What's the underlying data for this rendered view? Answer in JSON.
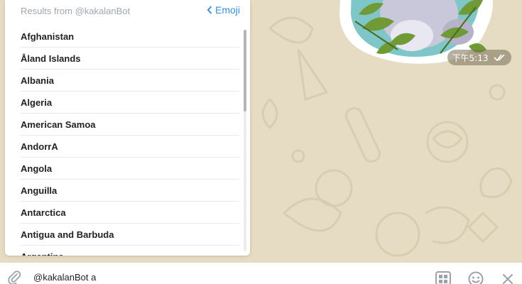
{
  "inline_results": {
    "title": "Results from @kakalanBot",
    "back_button": {
      "label": "Emoji",
      "icon": "chevron-left-icon"
    },
    "items": [
      "Afghanistan",
      "Åland Islands",
      "Albania",
      "Algeria",
      "American Samoa",
      "AndorrA",
      "Angola",
      "Anguilla",
      "Antarctica",
      "Antigua and Barbuda",
      "Argentina"
    ]
  },
  "message": {
    "time": "下午5:13",
    "status_icon": "double-check-icon"
  },
  "composer": {
    "input_value": "@kakalanBot a",
    "icons": [
      "paperclip-icon",
      "bot-keyboard-icon",
      "emoji-icon",
      "close-icon"
    ]
  },
  "colors": {
    "chat_background": "#e6dcc4",
    "accent": "#3a8ed5",
    "muted_text": "#a1a7ad"
  }
}
